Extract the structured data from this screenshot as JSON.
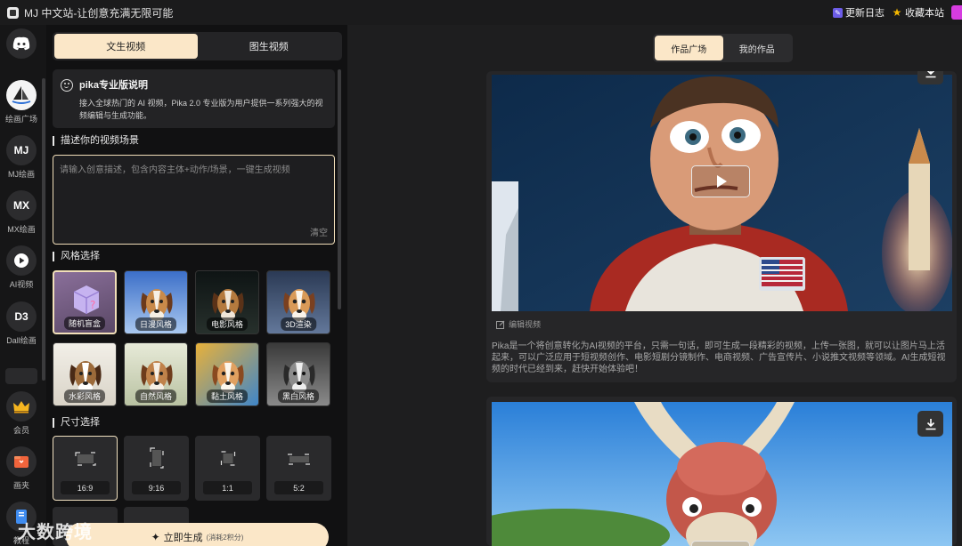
{
  "topbar": {
    "title": "MJ 中文站-让创意充满无限可能",
    "changelog": "更新日志",
    "bookmark": "收藏本站"
  },
  "nav": [
    {
      "label": "",
      "icon": "discord-icon"
    },
    {
      "label": "绘画广场",
      "icon": "sailboat-logo-icon"
    },
    {
      "label": "MJ绘画",
      "badge": "MJ"
    },
    {
      "label": "MX绘画",
      "badge": "MX"
    },
    {
      "label": "AI视频",
      "icon": "play-circle-icon"
    },
    {
      "label": "Dall绘画",
      "badge": "D3"
    },
    {
      "label": "会员",
      "icon": "crown-icon"
    },
    {
      "label": "画夹",
      "icon": "folder-icon"
    },
    {
      "label": "教程",
      "icon": "book-icon"
    }
  ],
  "panel": {
    "tabs": [
      "文生视频",
      "图生视频"
    ],
    "active_tab": 0,
    "info": {
      "title": "pika专业版说明",
      "text": "接入全球热门的 AI 视频，Pika 2.0 专业版为用户提供一系列强大的视频编辑与生成功能。"
    },
    "scene_title": "描述你的视频场景",
    "prompt_placeholder": "请输入创意描述，包含内容主体+动作/场景，一键生成视频",
    "clear": "清空",
    "style_title": "风格选择",
    "styles": [
      "随机盲盒",
      "日漫风格",
      "电影风格",
      "3D渲染",
      "水彩风格",
      "自然风格",
      "黏土风格",
      "黑白风格"
    ],
    "selected_style": 0,
    "size_title": "尺寸选择",
    "sizes": [
      "16:9",
      "9:16",
      "1:1",
      "5:2"
    ],
    "selected_size": 0,
    "generate": "立即生成",
    "generate_cost": "(消耗2积分)"
  },
  "right": {
    "tabs": [
      "作品广场",
      "我的作品"
    ],
    "active_tab": 0,
    "edit_video": "编辑视频",
    "description": "Pika是一个将创意转化为AI视频的平台，只需一句话，即可生成一段精彩的视频，上传一张图，就可以让图片马上活起来，可以广泛应用于短视频创作、电影短剧分镜制作、电商视频、广告宣传片、小说推文视频等领域。AI生成短视频的时代已经到来，赶快开始体验吧！"
  },
  "watermark": "大数跨境",
  "colors": {
    "accent": "#fbe7c8",
    "panel": "#111112",
    "card": "#262628"
  }
}
